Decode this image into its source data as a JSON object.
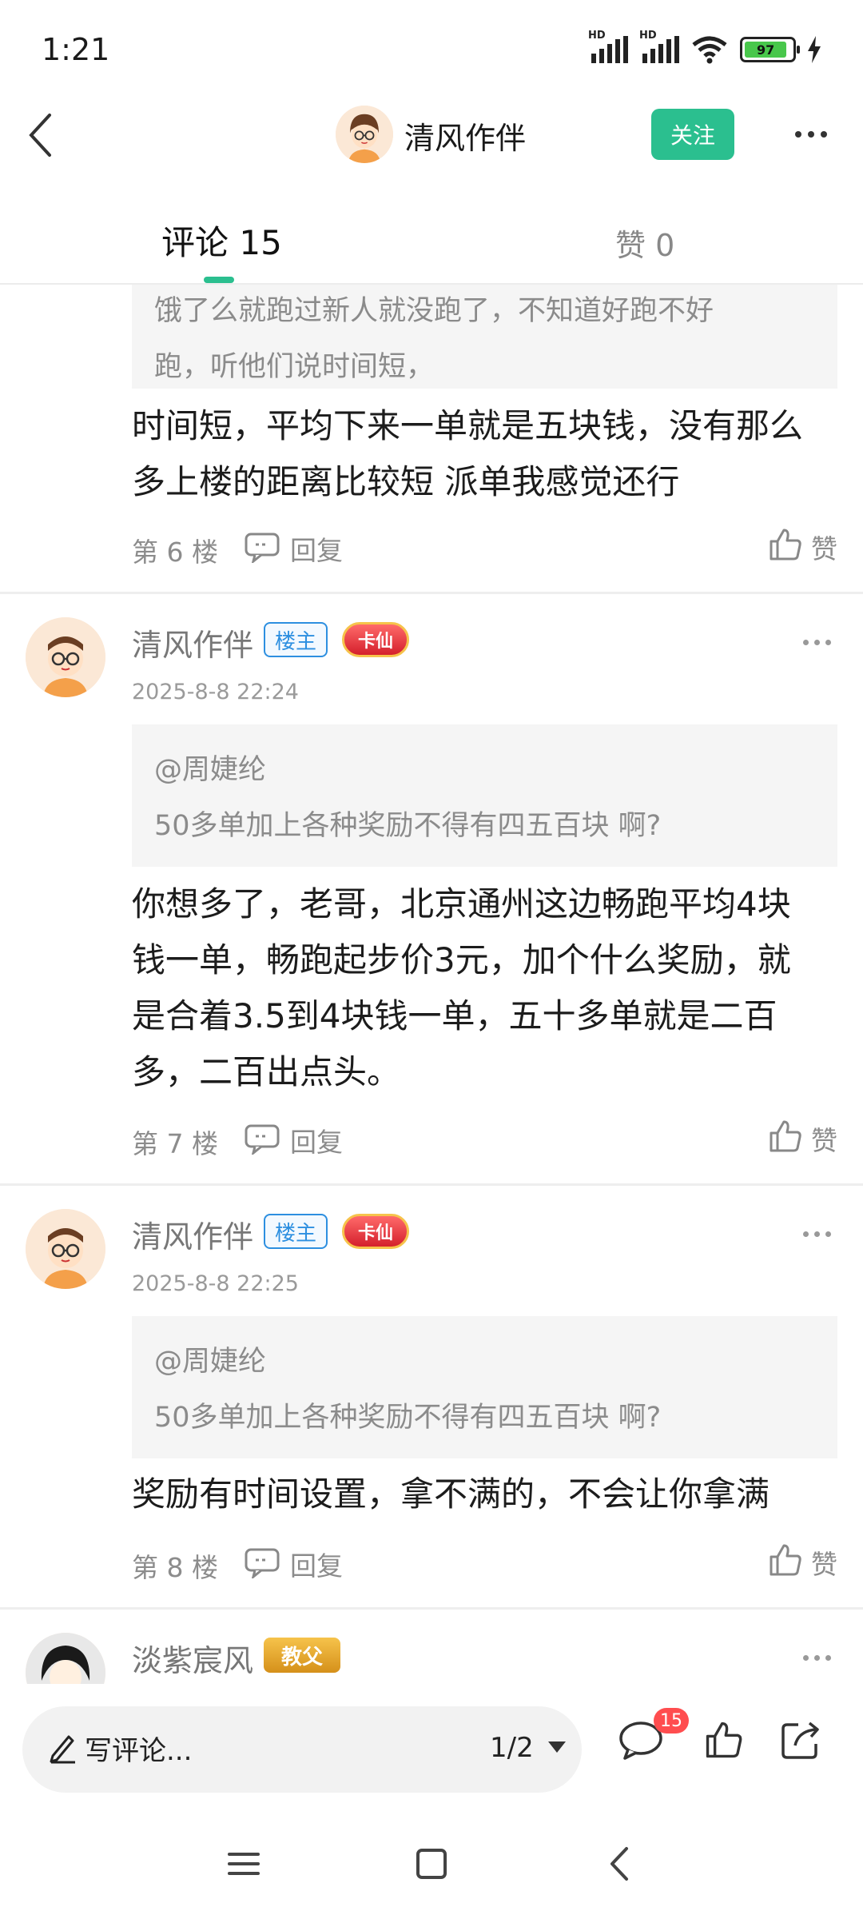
{
  "status_bar": {
    "time": "1:21",
    "battery": "97",
    "hd1": "HD",
    "hd2": "HD"
  },
  "header": {
    "author_name": "清风作伴",
    "follow_label": "关注"
  },
  "tabs": {
    "comments": "评论 15",
    "likes": "赞 0"
  },
  "comments": [
    {
      "quote_lines": [
        "饿了么就跑过新人就没跑了，不知道好跑不好",
        "跑，听他们说时间短，"
      ],
      "body_lines": [
        "时间短，平均下来一单就是五块钱，没有那么",
        "多上楼的距离比较短  派单我感觉还行"
      ],
      "floor": "第 6 楼",
      "reply_label": "回复",
      "like_label": "赞"
    },
    {
      "author": "清风作伴",
      "host_badge": "楼主",
      "medal": "卡仙",
      "time": "2025-8-8 22:24",
      "quote_lines": [
        "@周婕纶",
        "50多单加上各种奖励不得有四五百块 啊?"
      ],
      "body_lines": [
        "你想多了，老哥，北京通州这边畅跑平均4块",
        "钱一单，畅跑起步价3元，加个什么奖励，就",
        "是合着3.5到4块钱一单，五十多单就是二百",
        "多，二百出点头。"
      ],
      "floor": "第 7 楼",
      "reply_label": "回复",
      "like_label": "赞"
    },
    {
      "author": "清风作伴",
      "host_badge": "楼主",
      "medal": "卡仙",
      "time": "2025-8-8 22:25",
      "quote_lines": [
        "@周婕纶",
        "50多单加上各种奖励不得有四五百块 啊?"
      ],
      "body_lines": [
        "奖励有时间设置，拿不满的，不会让你拿满"
      ],
      "floor": "第 8 楼",
      "reply_label": "回复",
      "like_label": "赞"
    },
    {
      "author": "淡紫宸风",
      "medal": "教父"
    }
  ],
  "bottom_bar": {
    "write_placeholder": "写评论...",
    "page_indicator": "1/2",
    "comment_count": "15"
  },
  "colors": {
    "accent": "#2bbf8f",
    "host_badge": "#2d8fe0",
    "badge_red": "#ff4d4f"
  }
}
